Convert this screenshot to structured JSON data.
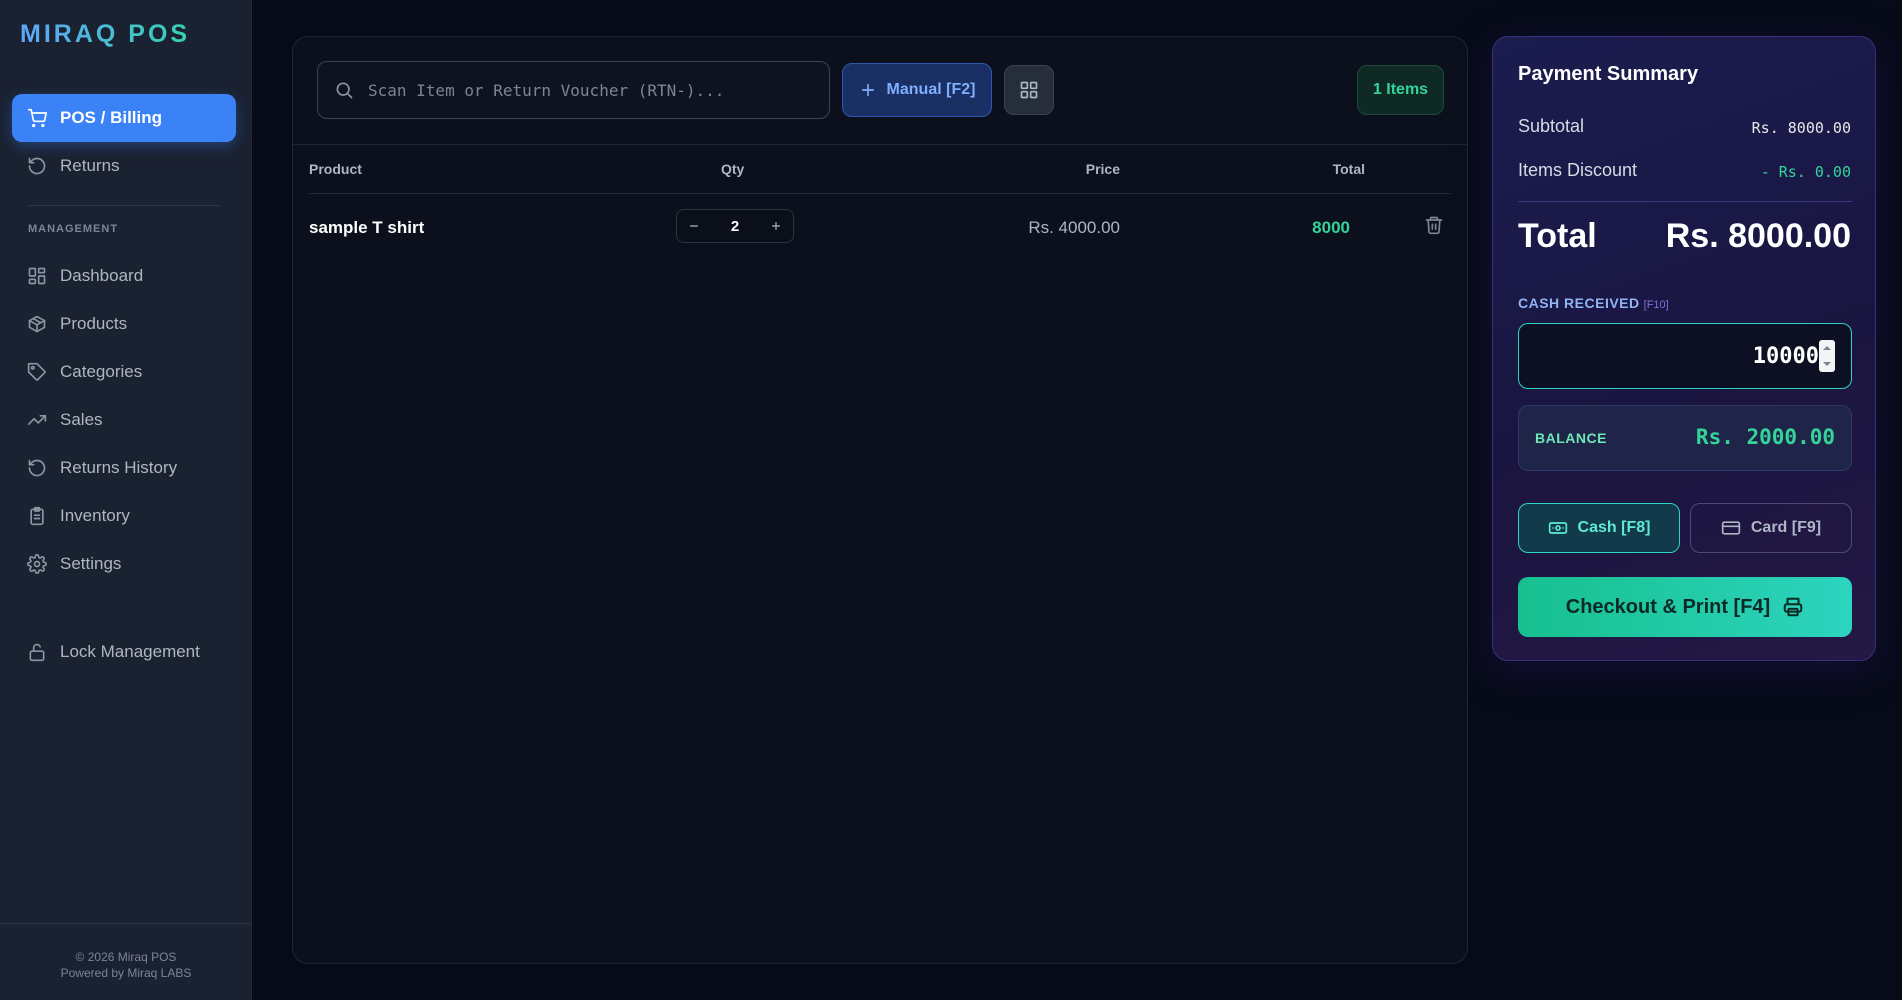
{
  "app": {
    "brand": "MIRAQ POS"
  },
  "sidebar": {
    "primary": [
      {
        "label": "POS / Billing",
        "icon": "cart-icon",
        "active": true
      },
      {
        "label": "Returns",
        "icon": "rotate-icon",
        "active": false
      }
    ],
    "section_label": "MANAGEMENT",
    "management": [
      {
        "label": "Dashboard",
        "icon": "grid-icon"
      },
      {
        "label": "Products",
        "icon": "package-icon"
      },
      {
        "label": "Categories",
        "icon": "tag-icon"
      },
      {
        "label": "Sales",
        "icon": "trend-icon"
      },
      {
        "label": "Returns History",
        "icon": "history-icon"
      },
      {
        "label": "Inventory",
        "icon": "clipboard-icon"
      },
      {
        "label": "Settings",
        "icon": "gear-icon"
      }
    ],
    "lock": {
      "label": "Lock Management",
      "icon": "lock-icon"
    },
    "footer": {
      "copyright": "© 2026 Miraq POS",
      "powered": "Powered by Miraq LABS"
    }
  },
  "toolbar": {
    "search_placeholder": "Scan Item or Return Voucher (RTN-)...",
    "search_value": "",
    "manual_label": "Manual [F2]",
    "items_badge": "1 Items"
  },
  "table": {
    "headers": {
      "product": "Product",
      "qty": "Qty",
      "price": "Price",
      "total": "Total"
    },
    "rows": [
      {
        "product": "sample T shirt",
        "qty": "2",
        "price": "Rs. 4000.00",
        "total": "8000"
      }
    ]
  },
  "payment": {
    "title": "Payment Summary",
    "subtotal_label": "Subtotal",
    "subtotal_value": "Rs. 8000.00",
    "discount_label": "Items Discount",
    "discount_value": "- Rs. 0.00",
    "total_label": "Total",
    "total_value": "Rs. 8000.00",
    "cash_received_label": "CASH RECEIVED",
    "cash_received_key": "[F10]",
    "cash_received_value": "10000",
    "balance_label": "BALANCE",
    "balance_value": "Rs. 2000.00",
    "cash_button": "Cash [F8]",
    "card_button": "Card [F9]",
    "checkout_button": "Checkout & Print [F4]"
  },
  "colors": {
    "accent_blue": "#3b82f6",
    "accent_green": "#34d399",
    "accent_teal": "#2dd4bf",
    "background": "#070b18",
    "sidebar": "#1a2130",
    "summary_panel": "#1b1d4f"
  }
}
